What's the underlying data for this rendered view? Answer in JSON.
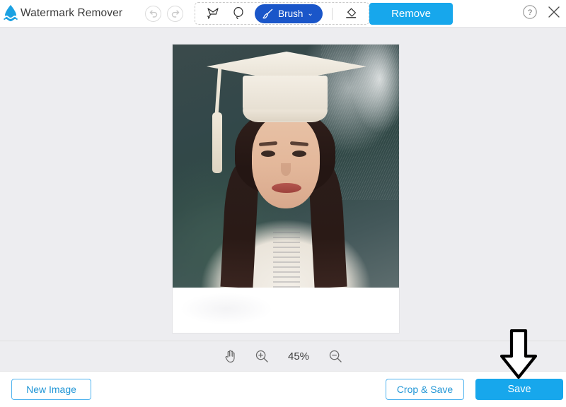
{
  "app": {
    "brand_name": "Watermark Remover",
    "logo_icon": "water-drop-logo",
    "accent_blue": "#17a7ec",
    "brush_blue": "#1a56c9",
    "outline_blue": "#4fb3ef",
    "canvas_bg": "#ededf0"
  },
  "header": {
    "history": [
      {
        "name": "undo",
        "icon": "undo-arrow-icon",
        "enabled": false
      },
      {
        "name": "redo",
        "icon": "redo-arrow-icon",
        "enabled": false
      }
    ],
    "tools": [
      {
        "name": "marquee",
        "icon": "magic-select-icon",
        "label": "",
        "active": false
      },
      {
        "name": "lasso",
        "icon": "lasso-icon",
        "label": "",
        "active": false
      },
      {
        "name": "brush",
        "icon": "brush-icon",
        "label": "Brush",
        "caret": "⌄",
        "active": true
      },
      {
        "name": "eraser",
        "icon": "eraser-icon",
        "label": "",
        "active": false
      }
    ],
    "remove_label": "Remove",
    "help_icon": "question-circle-icon",
    "close_icon": "close-x-icon"
  },
  "canvas": {
    "image_alt": "graduation-portrait-photo",
    "erased_region_note": "white-cleared-strip"
  },
  "zoombar": {
    "hand_icon": "hand-pan-icon",
    "zoom_in_icon": "zoom-in-icon",
    "zoom_out_icon": "zoom-out-icon",
    "zoom_level": "45%"
  },
  "footer": {
    "new_image_label": "New Image",
    "crop_save_label": "Crop & Save",
    "save_label": "Save"
  },
  "annotation": {
    "arrow_icon": "down-arrow-annotation",
    "target": "save-button"
  }
}
